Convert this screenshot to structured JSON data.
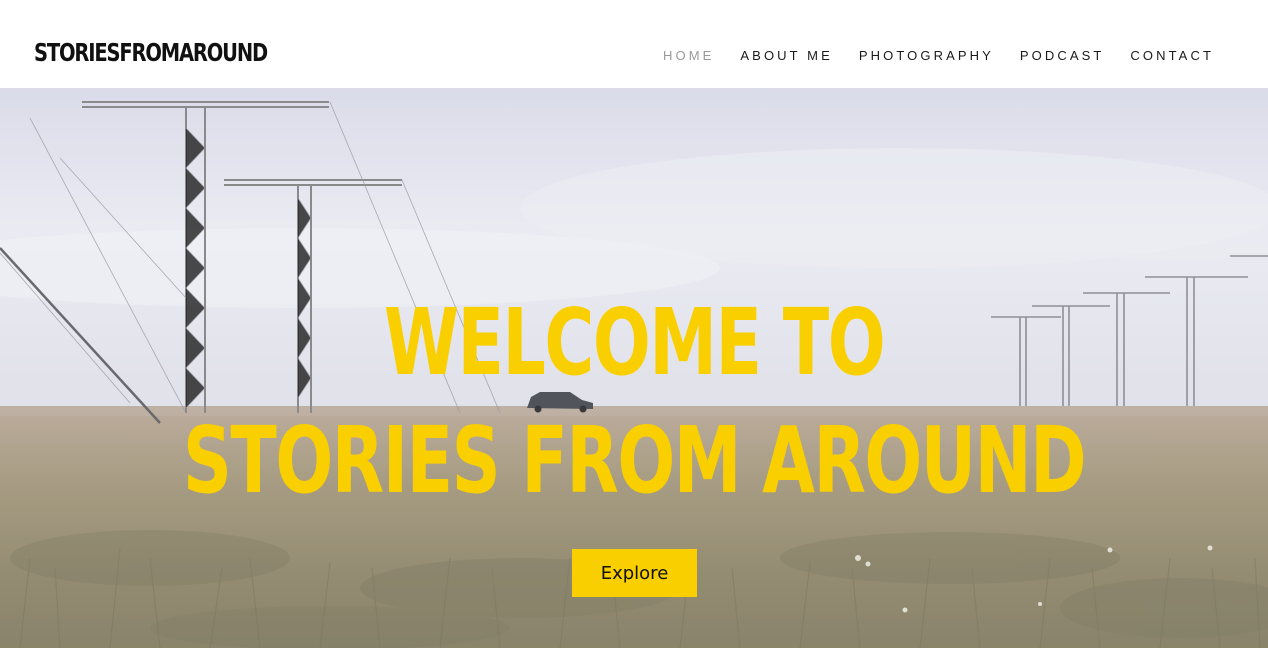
{
  "site": {
    "logo": "STORIESFROMAROUND"
  },
  "nav": {
    "items": [
      {
        "label": "HOME",
        "active": true
      },
      {
        "label": "ABOUT ME",
        "active": false
      },
      {
        "label": "PHOTOGRAPHY",
        "active": false
      },
      {
        "label": "PODCAST",
        "active": false
      },
      {
        "label": "CONTACT",
        "active": false
      }
    ]
  },
  "hero": {
    "line1": "WELCOME TO",
    "line2": "STORIES FROM AROUND",
    "cta_label": "Explore",
    "accent_color": "#f9cf00"
  }
}
